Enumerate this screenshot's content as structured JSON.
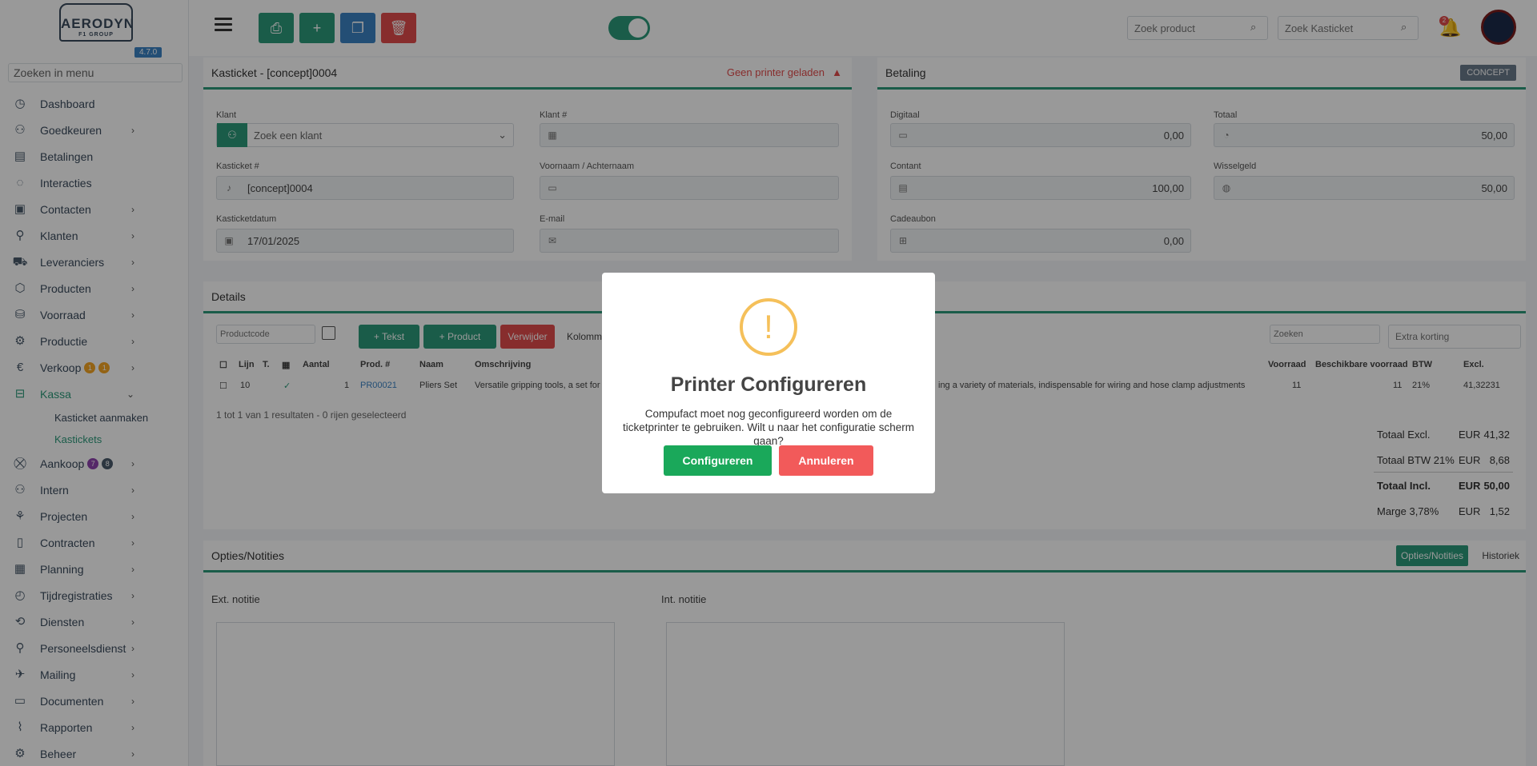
{
  "sidebar": {
    "logo_title": "AERODYN",
    "logo_sub": "F1 GROUP",
    "version": "4.7.0",
    "search_placeholder": "Zoeken in menu",
    "items": [
      {
        "label": "Dashboard",
        "icon": "dashboard-icon",
        "chev": ""
      },
      {
        "label": "Goedkeuren",
        "icon": "users-check-icon",
        "chev": "›"
      },
      {
        "label": "Betalingen",
        "icon": "payments-icon",
        "chev": ""
      },
      {
        "label": "Interacties",
        "icon": "chat-icon",
        "chev": ""
      },
      {
        "label": "Contacten",
        "icon": "contacts-icon",
        "chev": "›"
      },
      {
        "label": "Klanten",
        "icon": "user-icon",
        "chev": "›"
      },
      {
        "label": "Leveranciers",
        "icon": "truck-icon",
        "chev": "›"
      },
      {
        "label": "Producten",
        "icon": "box-icon",
        "chev": "›"
      },
      {
        "label": "Voorraad",
        "icon": "stock-icon",
        "chev": "›"
      },
      {
        "label": "Productie",
        "icon": "production-icon",
        "chev": "›"
      },
      {
        "label": "Verkoop",
        "icon": "euro-icon",
        "chev": "›",
        "badges": [
          "1",
          "1"
        ]
      },
      {
        "label": "Kassa",
        "icon": "register-icon",
        "chev": "⌄",
        "active": true
      }
    ],
    "sub_items": [
      {
        "label": "Kasticket aanmaken"
      },
      {
        "label": "Kastickets",
        "active": true
      }
    ],
    "items2": [
      {
        "label": "Aankoop",
        "icon": "cart-icon",
        "chev": "›",
        "badges": [
          "7",
          "8"
        ]
      },
      {
        "label": "Intern",
        "icon": "team-icon",
        "chev": "›"
      },
      {
        "label": "Projecten",
        "icon": "projects-icon",
        "chev": "›"
      },
      {
        "label": "Contracten",
        "icon": "contract-icon",
        "chev": "›"
      },
      {
        "label": "Planning",
        "icon": "calendar-icon",
        "chev": "›"
      },
      {
        "label": "Tijdregistraties",
        "icon": "clock-icon",
        "chev": "›"
      },
      {
        "label": "Diensten",
        "icon": "services-icon",
        "chev": "›"
      },
      {
        "label": "Personeelsdienst",
        "icon": "hr-icon",
        "chev": "›"
      },
      {
        "label": "Mailing",
        "icon": "mail-icon",
        "chev": "›"
      },
      {
        "label": "Documenten",
        "icon": "folder-icon",
        "chev": "›"
      },
      {
        "label": "Rapporten",
        "icon": "report-icon",
        "chev": "›"
      },
      {
        "label": "Beheer",
        "icon": "admin-icon",
        "chev": "›"
      }
    ]
  },
  "topbar": {
    "search_product_placeholder": "Zoek product",
    "search_customer_placeholder": "Zoek Kasticket",
    "notification_count": "2"
  },
  "ticket": {
    "title": "Kasticket - [concept]0004",
    "printer_warning": "Geen printer geladen",
    "klant_label": "Klant",
    "klant_placeholder": "Zoek een klant",
    "klant_nr_label": "Klant #",
    "klant_nr_value": "",
    "kasticket_label": "Kasticket #",
    "kasticket_value": "[concept]0004",
    "naam_label": "Voornaam / Achternaam",
    "naam_value": "",
    "datum_label": "Kasticketdatum",
    "datum_value": "17/01/2025",
    "email_label": "E-mail",
    "email_value": ""
  },
  "payment": {
    "title": "Betaling",
    "badge": "CONCEPT",
    "digitaal_label": "Digitaal",
    "digitaal_value": "0,00",
    "totaal_label": "Totaal",
    "totaal_value": "50,00",
    "contant_label": "Contant",
    "contant_value": "100,00",
    "wisselgeld_label": "Wisselgeld",
    "wisselgeld_value": "50,00",
    "cadeaubon_label": "Cadeaubon",
    "cadeaubon_value": "0,00"
  },
  "details": {
    "title": "Details",
    "product_placeholder": "Productcode",
    "btn_tekst": "+ Tekst",
    "btn_product": "+ Product",
    "btn_verwijder": "Verwijder",
    "kolommen": "Kolommen",
    "zoeken_placeholder": "Zoeken",
    "korting_placeholder": "Extra korting",
    "columns": [
      "Lijn",
      "T.",
      "Aantal",
      "Prod. #",
      "Naam",
      "Omschrijving",
      "Voorraad",
      "Beschikbare voorraad",
      "BTW",
      "Excl."
    ],
    "row": {
      "lijn": "10",
      "check": "✓",
      "aantal": "1",
      "prod": "PR00021",
      "naam": "Pliers Set",
      "omschrijving": "Versatile gripping tools, a set for",
      "omschrijving_end": "ing a variety of materials, indispensable for wiring and hose clamp adjustments",
      "voorraad": "11",
      "beschikbaar": "11",
      "btw": "21%",
      "excl": "41,32231"
    },
    "pagination": "1 tot 1 van 1 resultaten - 0 rijen geselecteerd",
    "totals": [
      {
        "label": "Totaal Excl.",
        "cur": "EUR",
        "value": "41,32"
      },
      {
        "label": "Totaal BTW 21%",
        "cur": "EUR",
        "value": "8,68"
      },
      {
        "label": "Totaal Incl.",
        "cur": "EUR",
        "value": "50,00"
      },
      {
        "label": "Marge 3,78%",
        "cur": "EUR",
        "value": "1,52"
      }
    ]
  },
  "notes": {
    "title": "Opties/Notities",
    "tab_active": "Opties/Notities",
    "tab_other": "Historiek",
    "ext_label": "Ext. notitie",
    "int_label": "Int. notitie"
  },
  "modal": {
    "icon_glyph": "!",
    "title": "Printer Configureren",
    "text": "Compufact moet nog geconfigureerd worden om de ticketprinter te gebruiken. Wilt u naar het configuratie scherm gaan?",
    "confirm": "Configureren",
    "cancel": "Annuleren"
  },
  "colors": {
    "primary": "#2c9a7a",
    "confirm": "#1aa85a",
    "cancel": "#f25a5a",
    "warning_icon": "#f5c05a"
  }
}
